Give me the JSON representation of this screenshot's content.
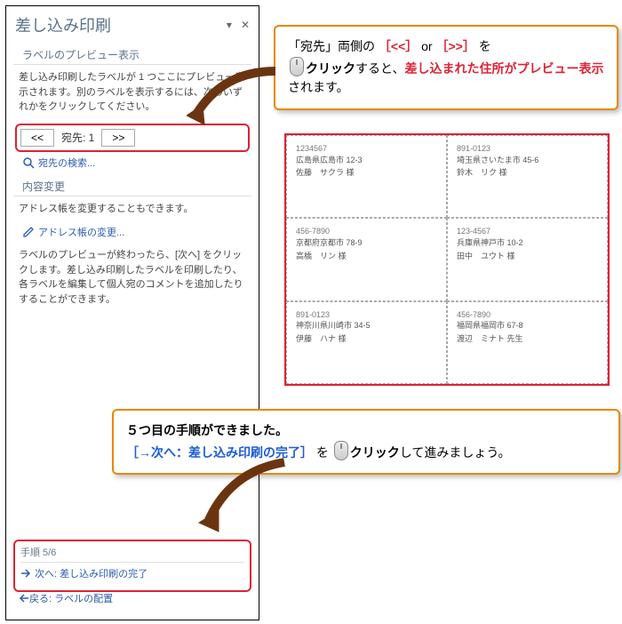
{
  "pane": {
    "title": "差し込み印刷",
    "section1": "ラベルのプレビュー表示",
    "desc1": "差し込み印刷したラベルが 1 つここにプレビュー表示されます。別のラベルを表示するには、次のいずれかをクリックしてください。",
    "prev": "<<",
    "next": ">>",
    "recipient_label": "宛先: 1",
    "find": "宛先の検索...",
    "section2": "内容変更",
    "desc2": "アドレス帳を変更することもできます。",
    "edit_link": "アドレス帳の変更...",
    "desc3": "ラベルのプレビューが終わったら、[次へ] をクリックします。差し込み印刷したラベルを印刷したり、各ラベルを編集して個人宛のコメントを追加したりすることができます。",
    "step": "手順 5/6",
    "next_step": "次へ: 差し込み印刷の完了",
    "back": "戻る: ラベルの配置"
  },
  "callout1": {
    "t1": "「宛先」両側の ",
    "t2": "［<<］",
    "t3": " or ",
    "t4": "［>>］",
    "t5": " を",
    "t6": "クリック",
    "t7": "すると、",
    "t8": "差し込まれた住所がプレビュー表示",
    "t9": "されます。"
  },
  "callout2": {
    "t1": "５つ目の手順ができました。",
    "t2": "［→次へ：差し込み印刷の完了］",
    "t3": " を ",
    "t4": "クリック",
    "t5": "して進みましょう。"
  },
  "preview": [
    {
      "zip": "1234567",
      "addr": "広島県広島市 12-3",
      "name": "佐藤　サクラ 様"
    },
    {
      "zip": "891-0123",
      "addr": "埼玉県さいたま市 45-6",
      "name": "鈴木　リク 様"
    },
    {
      "zip": "456-7890",
      "addr": "京都府京都市 78-9",
      "name": "高橋　リン 様"
    },
    {
      "zip": "123-4567",
      "addr": "兵庫県神戸市 10-2",
      "name": "田中　ユウト 様"
    },
    {
      "zip": "891-0123",
      "addr": "神奈川県川崎市 34-5",
      "name": "伊藤　ハナ 様"
    },
    {
      "zip": "456-7890",
      "addr": "福岡県福岡市 67-8",
      "name": "渡辺　ミナト 先生"
    }
  ]
}
